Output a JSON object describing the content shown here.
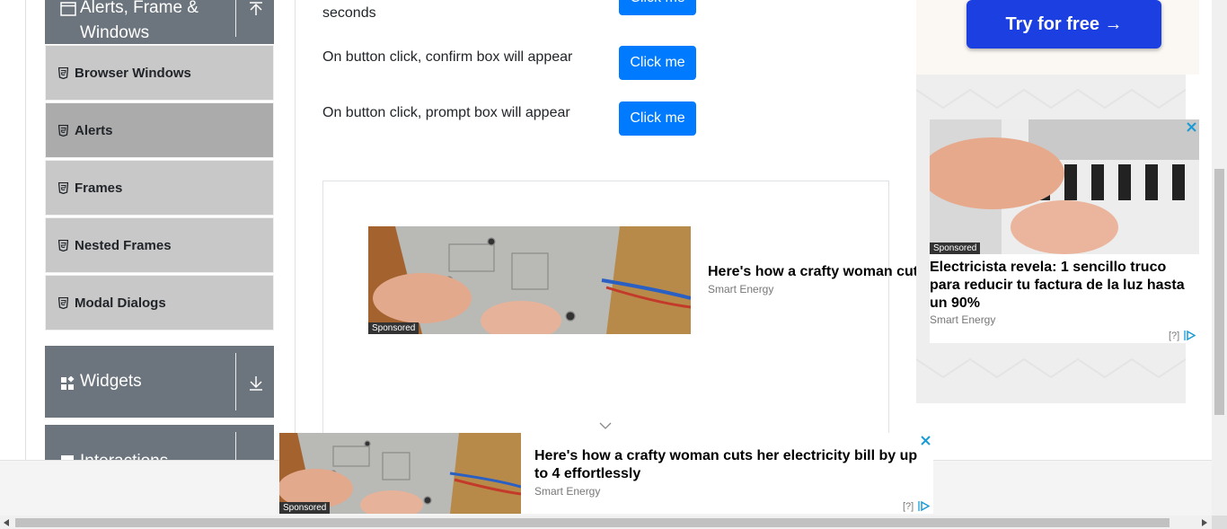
{
  "sidebar": {
    "group_alerts": {
      "label_line1": "Alerts, Frame &",
      "label_line2": "Windows"
    },
    "items": [
      {
        "label": "Browser Windows"
      },
      {
        "label": "Alerts"
      },
      {
        "label": "Frames"
      },
      {
        "label": "Nested Frames"
      },
      {
        "label": "Modal Dialogs"
      }
    ],
    "group_widgets": {
      "label": "Widgets"
    },
    "group_interactions": {
      "label": "Interactions"
    }
  },
  "main": {
    "rows": [
      {
        "text": "seconds",
        "button": "Click me"
      },
      {
        "text": "On button click, confirm box will appear",
        "button": "Click me"
      },
      {
        "text": "On button click, prompt box will appear",
        "button": "Click me"
      }
    ]
  },
  "inline_ad": {
    "sponsored": "Sponsored",
    "title": "Here's how a crafty woman cut",
    "source": "Smart Energy"
  },
  "right_ad": {
    "cta": "Try for free →",
    "sponsored": "Sponsored",
    "title": "Electricista revela: 1 sencillo truco para reducir tu factura de la luz hasta un 90%",
    "source": "Smart Energy",
    "adchoice": "[?]"
  },
  "bottom_ad": {
    "sponsored": "Sponsored",
    "title": "Here's how a crafty woman cuts her electricity bill by up to 4 effortlessly",
    "source": "Smart Energy",
    "adchoice": "[?]"
  },
  "colors": {
    "primary": "#007bff",
    "sidebar_header": "#6c757d",
    "menu_item": "#c8c8c8",
    "menu_active": "#ababab",
    "cta": "#1b3fe0"
  }
}
